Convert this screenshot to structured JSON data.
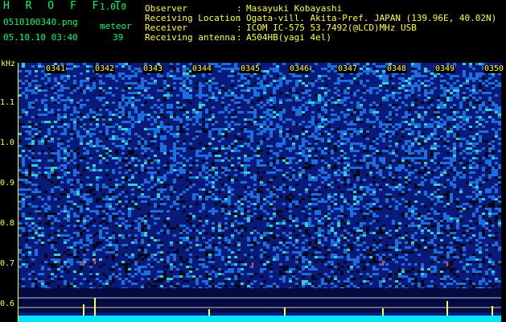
{
  "header": {
    "app_title": "H R O F F T",
    "app_version": "1.0.0",
    "filename": "0510100340.png",
    "datetime": "05.10.10 03:40",
    "meteor_label": "meteor",
    "meteor_count": "39",
    "info": [
      {
        "label": "Observer",
        "value": "Masayuki Kobayashi"
      },
      {
        "label": "Receiving Location",
        "value": "Ogata-vill. Akita-Pref. JAPAN (139.96E, 40.02N)"
      },
      {
        "label": "Receiver",
        "value": "ICOM IC-575 53.7492(@LCD)MHz USB"
      },
      {
        "label": "Receiving antenna",
        "value": "A504HB(yagi 4el)"
      }
    ]
  },
  "chart_data": {
    "type": "heatmap",
    "ylabel": "kHz",
    "y_ticks": [
      "1.1",
      "1.0",
      "0.9",
      "0.8",
      "0.7",
      "0.6"
    ],
    "x_ticks": [
      "0341",
      "0342",
      "0343",
      "0344",
      "0345",
      "0346",
      "0347",
      "0348",
      "0349",
      "0350"
    ]
  },
  "colors": {
    "label": "#ffff33",
    "title": "#00ff66",
    "background": "#000000",
    "noise_low": "#0a1a7a",
    "noise_mid": "#1a6fe0",
    "noise_high": "#33d0d0",
    "baseline": "#00e5ff"
  }
}
